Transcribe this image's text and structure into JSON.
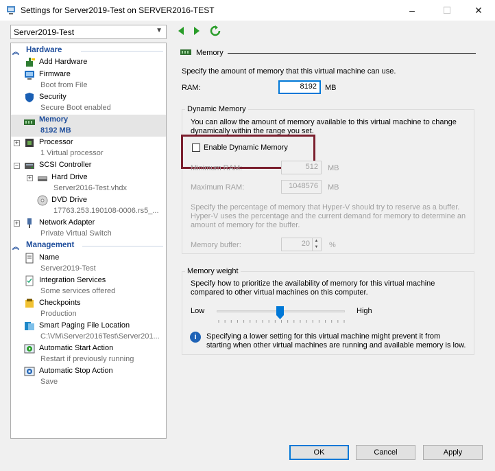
{
  "window": {
    "title": "Settings for Server2019-Test on SERVER2016-TEST",
    "controls": [
      "–",
      "☐",
      "✕"
    ]
  },
  "vm_selector": {
    "value": "Server2019-Test"
  },
  "tree": {
    "hardware_label": "Hardware",
    "management_label": "Management",
    "add_hardware": "Add Hardware",
    "firmware": {
      "label": "Firmware",
      "sub": "Boot from File"
    },
    "security": {
      "label": "Security",
      "sub": "Secure Boot enabled"
    },
    "memory": {
      "label": "Memory",
      "sub": "8192 MB"
    },
    "processor": {
      "label": "Processor",
      "sub": "1 Virtual processor"
    },
    "scsi": {
      "label": "SCSI Controller"
    },
    "hard_drive": {
      "label": "Hard Drive",
      "sub": "Server2016-Test.vhdx"
    },
    "dvd": {
      "label": "DVD Drive",
      "sub": "17763.253.190108-0006.rs5_..."
    },
    "network": {
      "label": "Network Adapter",
      "sub": "Private Virtual Switch"
    },
    "name": {
      "label": "Name",
      "sub": "Server2019-Test"
    },
    "integration": {
      "label": "Integration Services",
      "sub": "Some services offered"
    },
    "checkpoints": {
      "label": "Checkpoints",
      "sub": "Production"
    },
    "paging": {
      "label": "Smart Paging File Location",
      "sub": "C:\\VM\\Server2016Test\\Server201..."
    },
    "auto_start": {
      "label": "Automatic Start Action",
      "sub": "Restart if previously running"
    },
    "auto_stop": {
      "label": "Automatic Stop Action",
      "sub": "Save"
    }
  },
  "memory_panel": {
    "header": "Memory",
    "intro": "Specify the amount of memory that this virtual machine can use.",
    "ram_label": "RAM:",
    "ram_value": "8192",
    "ram_unit": "MB",
    "dynamic": {
      "title": "Dynamic Memory",
      "desc_line1": "You can allow the amount of memory available to this virtual machine to change",
      "desc_line2": "dynamically within the range you set.",
      "enable_label": "Enable Dynamic Memory",
      "enable_checked": false,
      "min_label": "Minimum RAM:",
      "min_value": "512",
      "min_unit": "MB",
      "max_label": "Maximum RAM:",
      "max_value": "1048576",
      "max_unit": "MB",
      "buffer_desc1": "Specify the percentage of memory that Hyper-V should try to reserve as a buffer.",
      "buffer_desc2": "Hyper-V uses the percentage and the current demand for memory to determine an",
      "buffer_desc3": "amount of memory for the buffer.",
      "buffer_label": "Memory buffer:",
      "buffer_value": "20",
      "buffer_unit": "%"
    },
    "weight": {
      "title": "Memory weight",
      "desc1": "Specify how to prioritize the availability of memory for this virtual machine",
      "desc2": "compared to other virtual machines on this computer.",
      "low": "Low",
      "high": "High",
      "slider_level": 0.5,
      "info1": "Specifying a lower setting for this virtual machine might prevent it from",
      "info2": "starting when other virtual machines are running and available memory is low."
    }
  },
  "buttons": {
    "ok": "OK",
    "cancel": "Cancel",
    "apply": "Apply"
  }
}
